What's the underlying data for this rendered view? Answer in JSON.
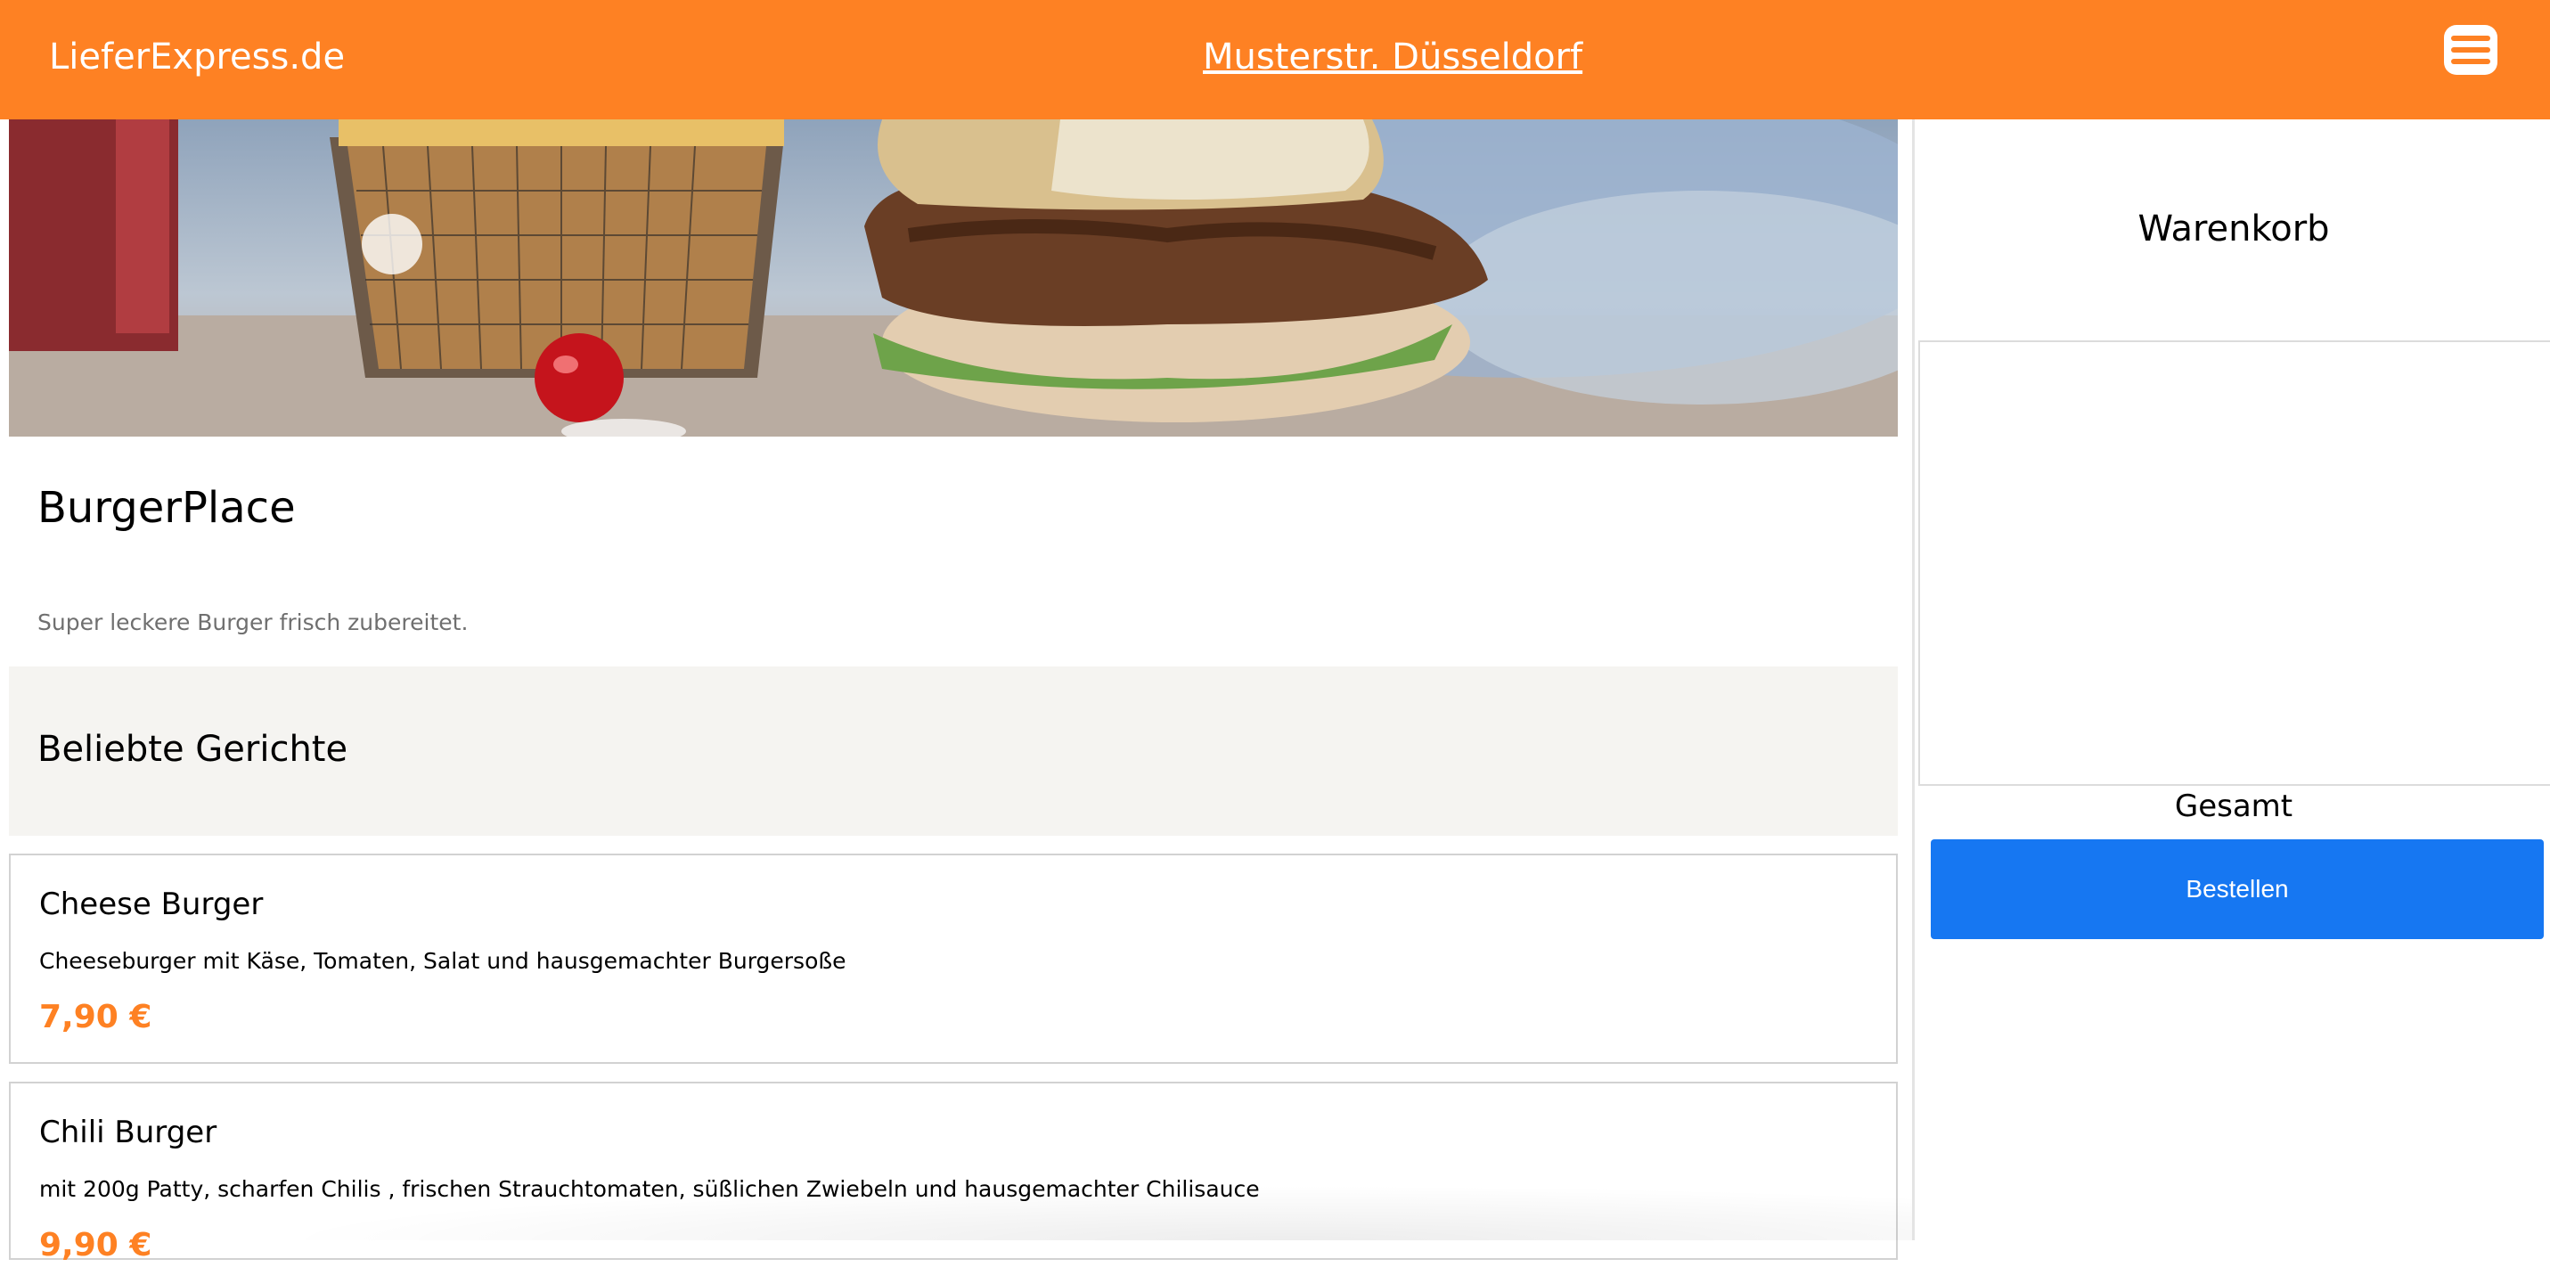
{
  "header": {
    "brand": "LieferExpress.de",
    "address": "Musterstr. Düsseldorf",
    "menu_icon": "hamburger-menu-icon",
    "background_color": "#fe8123"
  },
  "restaurant": {
    "name": "BurgerPlace",
    "description": "Super leckere Burger frisch zubereitet."
  },
  "popular": {
    "title": "Beliebte Gerichte"
  },
  "dishes": [
    {
      "name": "Cheese Burger",
      "description": "Cheeseburger mit Käse, Tomaten, Salat und hausgemachter Burgersoße",
      "price": "7,90 €"
    },
    {
      "name": "Chili Burger",
      "description": "mit 200g Patty, scharfen Chilis , frischen Strauchtomaten, süßlichen Zwiebeln und hausgemachter Chilisauce",
      "price": "9,90 €"
    }
  ],
  "cart": {
    "title": "Warenkorb",
    "total_label": "Gesamt",
    "order_button": "Bestellen",
    "button_color": "#1677f2"
  },
  "colors": {
    "accent": "#fe8123",
    "popular_band": "#f5f4f1"
  }
}
